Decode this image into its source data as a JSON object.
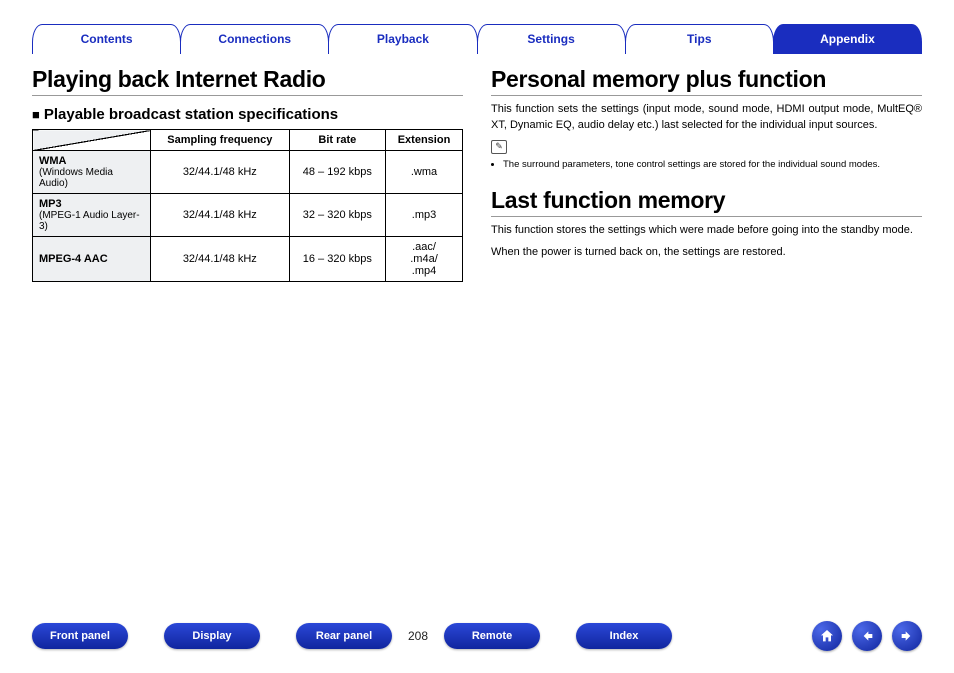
{
  "tabs": {
    "items": [
      {
        "label": "Contents",
        "active": false
      },
      {
        "label": "Connections",
        "active": false
      },
      {
        "label": "Playback",
        "active": false
      },
      {
        "label": "Settings",
        "active": false
      },
      {
        "label": "Tips",
        "active": false
      },
      {
        "label": "Appendix",
        "active": true
      }
    ]
  },
  "left": {
    "title": "Playing back Internet Radio",
    "subtitle_marker": "■",
    "subtitle": "Playable broadcast station specifications",
    "table": {
      "headers": {
        "sampling": "Sampling frequency",
        "bitrate": "Bit rate",
        "ext": "Extension"
      },
      "rows": [
        {
          "fmt": "WMA",
          "desc": "(Windows Media Audio)",
          "samp": "32/44.1/48 kHz",
          "rate": "48 – 192 kbps",
          "ext": ".wma"
        },
        {
          "fmt": "MP3",
          "desc": "(MPEG-1 Audio Layer-3)",
          "samp": "32/44.1/48 kHz",
          "rate": "32 – 320 kbps",
          "ext": ".mp3"
        },
        {
          "fmt": "MPEG-4 AAC",
          "desc": "",
          "samp": "32/44.1/48 kHz",
          "rate": "16 – 320 kbps",
          "ext": ".aac/\n.m4a/\n.mp4"
        }
      ]
    }
  },
  "right": {
    "title1": "Personal memory plus function",
    "para1": "This function sets the settings (input mode, sound mode, HDMI output mode, MultEQ® XT, Dynamic EQ, audio delay etc.) last selected for the individual input sources.",
    "note1": "The surround parameters, tone control settings are stored for the individual sound modes.",
    "title2": "Last function memory",
    "para2a": "This function stores the settings which were made before going into the standby mode.",
    "para2b": "When the power is turned back on, the settings are restored."
  },
  "footer": {
    "buttons": {
      "front": "Front panel",
      "display": "Display",
      "rear": "Rear panel",
      "remote": "Remote",
      "index": "Index"
    },
    "page": "208"
  }
}
